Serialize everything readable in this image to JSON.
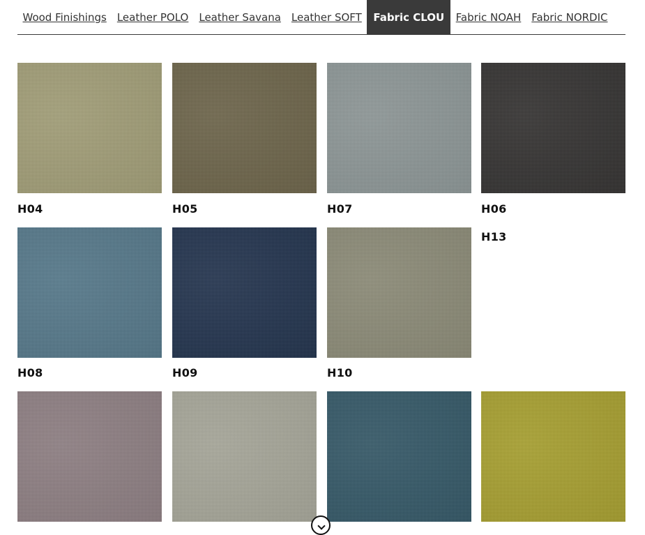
{
  "tabs": [
    {
      "label": "Wood Finishings",
      "active": false
    },
    {
      "label": "Leather POLO",
      "active": false
    },
    {
      "label": "Leather Savana",
      "active": false
    },
    {
      "label": "Leather SOFT",
      "active": false
    },
    {
      "label": "Fabric CLOU",
      "active": true
    },
    {
      "label": "Fabric NOAH",
      "active": false
    },
    {
      "label": "Fabric NORDIC",
      "active": false
    }
  ],
  "swatches": [
    {
      "code": "H04",
      "color": "#a39f76"
    },
    {
      "code": "H05",
      "color": "#6b6246"
    },
    {
      "code": "H07",
      "color": "#8d9797"
    },
    {
      "code": "H06",
      "color": "#2f2d2c"
    },
    {
      "code": "H08",
      "color": "#52778a"
    },
    {
      "code": "H09",
      "color": "#1c2e4a"
    },
    {
      "code": "H10",
      "color": "#8c8b76"
    },
    {
      "code": "H13",
      "color": ""
    },
    {
      "code": "",
      "color": "#8e7e82"
    },
    {
      "code": "",
      "color": "#a8a89a"
    },
    {
      "code": "",
      "color": "#2f5565"
    },
    {
      "code": "",
      "color": "#a9a12a"
    }
  ]
}
